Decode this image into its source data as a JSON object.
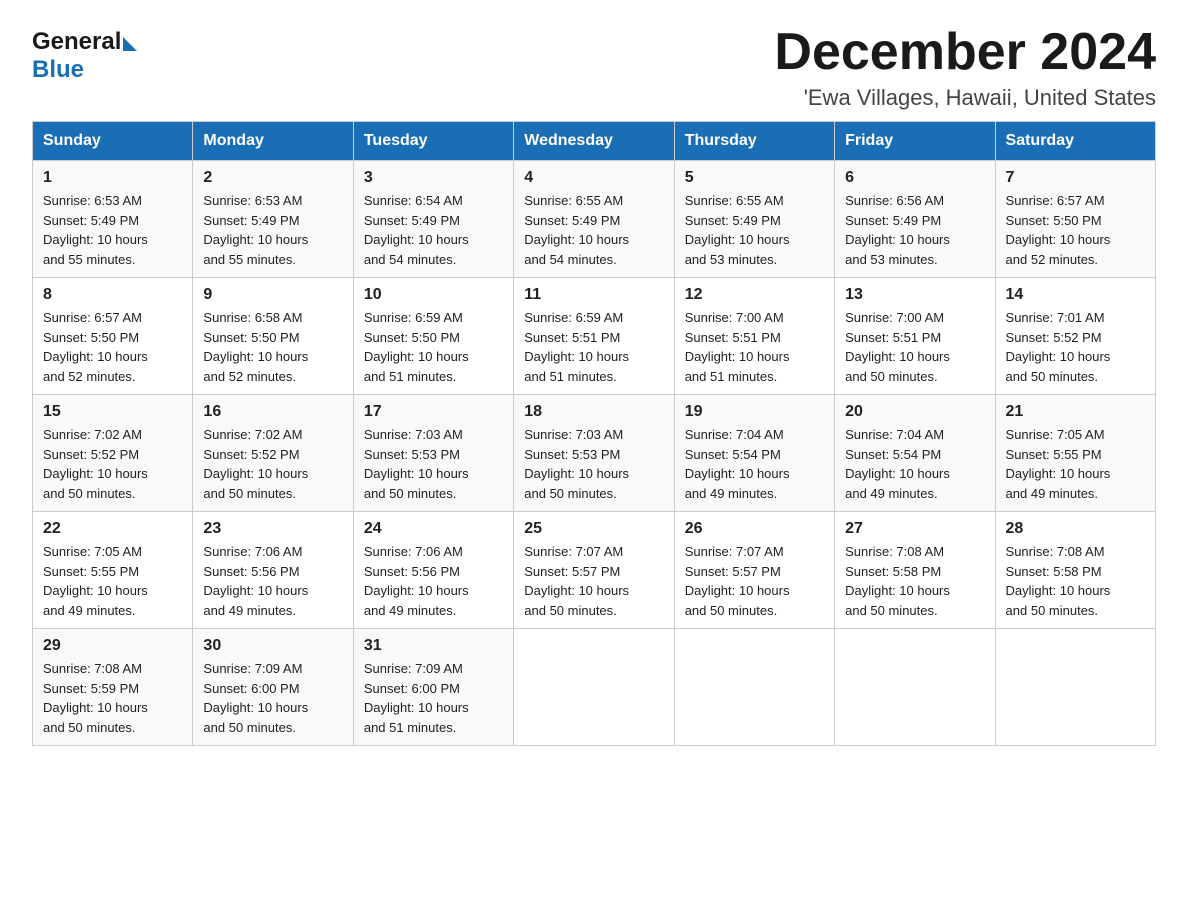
{
  "header": {
    "month_title": "December 2024",
    "location": "'Ewa Villages, Hawaii, United States",
    "logo_general": "General",
    "logo_blue": "Blue"
  },
  "days_of_week": [
    "Sunday",
    "Monday",
    "Tuesday",
    "Wednesday",
    "Thursday",
    "Friday",
    "Saturday"
  ],
  "weeks": [
    [
      {
        "day": "1",
        "sunrise": "6:53 AM",
        "sunset": "5:49 PM",
        "daylight": "10 hours and 55 minutes."
      },
      {
        "day": "2",
        "sunrise": "6:53 AM",
        "sunset": "5:49 PM",
        "daylight": "10 hours and 55 minutes."
      },
      {
        "day": "3",
        "sunrise": "6:54 AM",
        "sunset": "5:49 PM",
        "daylight": "10 hours and 54 minutes."
      },
      {
        "day": "4",
        "sunrise": "6:55 AM",
        "sunset": "5:49 PM",
        "daylight": "10 hours and 54 minutes."
      },
      {
        "day": "5",
        "sunrise": "6:55 AM",
        "sunset": "5:49 PM",
        "daylight": "10 hours and 53 minutes."
      },
      {
        "day": "6",
        "sunrise": "6:56 AM",
        "sunset": "5:49 PM",
        "daylight": "10 hours and 53 minutes."
      },
      {
        "day": "7",
        "sunrise": "6:57 AM",
        "sunset": "5:50 PM",
        "daylight": "10 hours and 52 minutes."
      }
    ],
    [
      {
        "day": "8",
        "sunrise": "6:57 AM",
        "sunset": "5:50 PM",
        "daylight": "10 hours and 52 minutes."
      },
      {
        "day": "9",
        "sunrise": "6:58 AM",
        "sunset": "5:50 PM",
        "daylight": "10 hours and 52 minutes."
      },
      {
        "day": "10",
        "sunrise": "6:59 AM",
        "sunset": "5:50 PM",
        "daylight": "10 hours and 51 minutes."
      },
      {
        "day": "11",
        "sunrise": "6:59 AM",
        "sunset": "5:51 PM",
        "daylight": "10 hours and 51 minutes."
      },
      {
        "day": "12",
        "sunrise": "7:00 AM",
        "sunset": "5:51 PM",
        "daylight": "10 hours and 51 minutes."
      },
      {
        "day": "13",
        "sunrise": "7:00 AM",
        "sunset": "5:51 PM",
        "daylight": "10 hours and 50 minutes."
      },
      {
        "day": "14",
        "sunrise": "7:01 AM",
        "sunset": "5:52 PM",
        "daylight": "10 hours and 50 minutes."
      }
    ],
    [
      {
        "day": "15",
        "sunrise": "7:02 AM",
        "sunset": "5:52 PM",
        "daylight": "10 hours and 50 minutes."
      },
      {
        "day": "16",
        "sunrise": "7:02 AM",
        "sunset": "5:52 PM",
        "daylight": "10 hours and 50 minutes."
      },
      {
        "day": "17",
        "sunrise": "7:03 AM",
        "sunset": "5:53 PM",
        "daylight": "10 hours and 50 minutes."
      },
      {
        "day": "18",
        "sunrise": "7:03 AM",
        "sunset": "5:53 PM",
        "daylight": "10 hours and 50 minutes."
      },
      {
        "day": "19",
        "sunrise": "7:04 AM",
        "sunset": "5:54 PM",
        "daylight": "10 hours and 49 minutes."
      },
      {
        "day": "20",
        "sunrise": "7:04 AM",
        "sunset": "5:54 PM",
        "daylight": "10 hours and 49 minutes."
      },
      {
        "day": "21",
        "sunrise": "7:05 AM",
        "sunset": "5:55 PM",
        "daylight": "10 hours and 49 minutes."
      }
    ],
    [
      {
        "day": "22",
        "sunrise": "7:05 AM",
        "sunset": "5:55 PM",
        "daylight": "10 hours and 49 minutes."
      },
      {
        "day": "23",
        "sunrise": "7:06 AM",
        "sunset": "5:56 PM",
        "daylight": "10 hours and 49 minutes."
      },
      {
        "day": "24",
        "sunrise": "7:06 AM",
        "sunset": "5:56 PM",
        "daylight": "10 hours and 49 minutes."
      },
      {
        "day": "25",
        "sunrise": "7:07 AM",
        "sunset": "5:57 PM",
        "daylight": "10 hours and 50 minutes."
      },
      {
        "day": "26",
        "sunrise": "7:07 AM",
        "sunset": "5:57 PM",
        "daylight": "10 hours and 50 minutes."
      },
      {
        "day": "27",
        "sunrise": "7:08 AM",
        "sunset": "5:58 PM",
        "daylight": "10 hours and 50 minutes."
      },
      {
        "day": "28",
        "sunrise": "7:08 AM",
        "sunset": "5:58 PM",
        "daylight": "10 hours and 50 minutes."
      }
    ],
    [
      {
        "day": "29",
        "sunrise": "7:08 AM",
        "sunset": "5:59 PM",
        "daylight": "10 hours and 50 minutes."
      },
      {
        "day": "30",
        "sunrise": "7:09 AM",
        "sunset": "6:00 PM",
        "daylight": "10 hours and 50 minutes."
      },
      {
        "day": "31",
        "sunrise": "7:09 AM",
        "sunset": "6:00 PM",
        "daylight": "10 hours and 51 minutes."
      },
      null,
      null,
      null,
      null
    ]
  ],
  "labels": {
    "sunrise": "Sunrise:",
    "sunset": "Sunset:",
    "daylight": "Daylight:"
  }
}
